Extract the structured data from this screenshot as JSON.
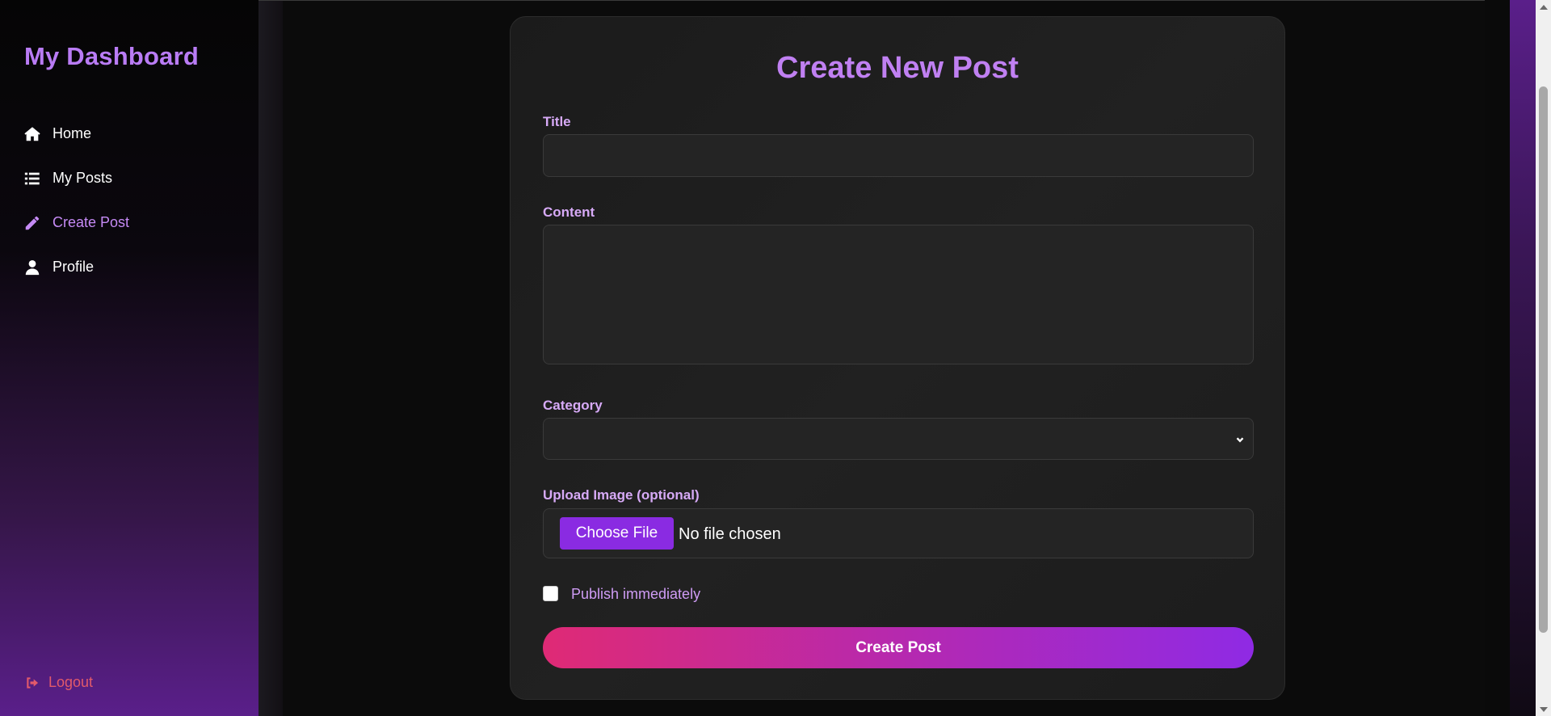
{
  "sidebar": {
    "brand": "My Dashboard",
    "items": [
      {
        "label": "Home",
        "icon": "home-icon"
      },
      {
        "label": "My Posts",
        "icon": "list-icon"
      },
      {
        "label": "Create Post",
        "icon": "pencil-icon",
        "active": true
      },
      {
        "label": "Profile",
        "icon": "user-icon"
      }
    ],
    "logout": {
      "label": "Logout",
      "icon": "logout-icon"
    }
  },
  "form": {
    "title": "Create New Post",
    "title_label": "Title",
    "title_value": "",
    "content_label": "Content",
    "content_value": "",
    "category_label": "Category",
    "category_value": "",
    "upload_label": "Upload Image (optional)",
    "file_button": "Choose File",
    "file_status": "No file chosen",
    "publish_label": "Publish immediately",
    "publish_checked": false,
    "submit_label": "Create Post"
  },
  "colors": {
    "accent": "#c080f2",
    "active_nav": "#c58af5",
    "logout": "#e25a6a",
    "file_button": "#8a2be2",
    "submit_gradient": [
      "#df2a75",
      "#8f2ae4"
    ]
  }
}
